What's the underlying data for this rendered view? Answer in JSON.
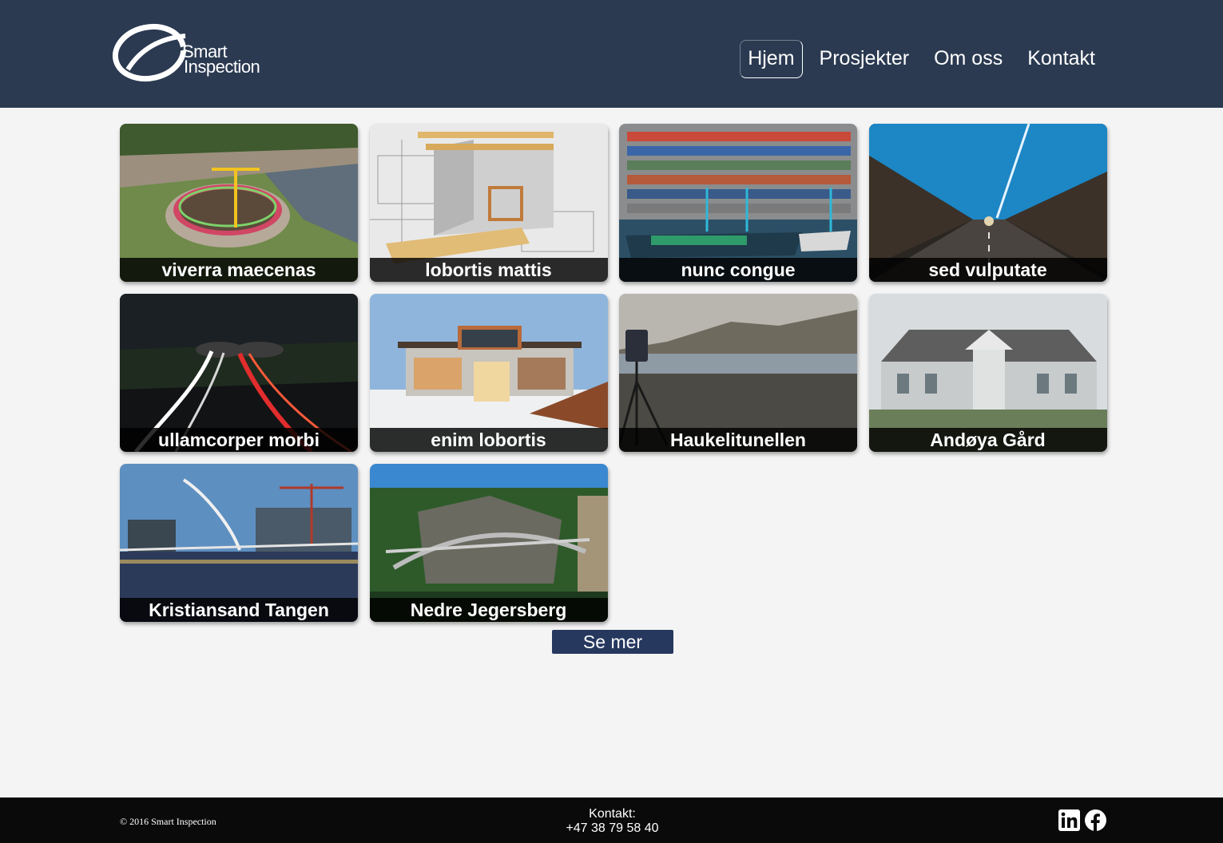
{
  "brand": {
    "logo_line1": "Smart",
    "logo_line2": "Inspection"
  },
  "nav": {
    "items": [
      {
        "label": "Hjem",
        "active": true
      },
      {
        "label": "Prosjekter",
        "active": false
      },
      {
        "label": "Om oss",
        "active": false
      },
      {
        "label": "Kontakt",
        "active": false
      }
    ]
  },
  "projects": [
    {
      "title": "viverra maecenas",
      "image": "dam-construction-photo"
    },
    {
      "title": "lobortis mattis",
      "image": "blueprint-construction-photo"
    },
    {
      "title": "nunc congue",
      "image": "container-port-photo"
    },
    {
      "title": "sed vulputate",
      "image": "tunnel-photo"
    },
    {
      "title": "ullamcorper morbi",
      "image": "highway-tunnel-night-photo"
    },
    {
      "title": "enim lobortis",
      "image": "modern-house-photo"
    },
    {
      "title": "Haukelitunellen",
      "image": "laser-scanner-landscape-photo"
    },
    {
      "title": "Andøya Gård",
      "image": "farmhouse-photo"
    },
    {
      "title": "Kristiansand Tangen",
      "image": "harbour-bridge-photo"
    },
    {
      "title": "Nedre Jegersberg",
      "image": "arch-bridge-photo"
    }
  ],
  "more_button": "Se mer",
  "footer": {
    "copyright": "© 2016 Smart Inspection",
    "contact_label": "Kontakt:",
    "contact_phone": "+47 38 79 58 40",
    "social": [
      "linkedin-icon",
      "facebook-icon"
    ]
  },
  "colors": {
    "header_bg": "#2b3a51",
    "page_bg": "#f4f4f4",
    "button_bg": "#26385e",
    "footer_bg": "#0a0a0a"
  }
}
